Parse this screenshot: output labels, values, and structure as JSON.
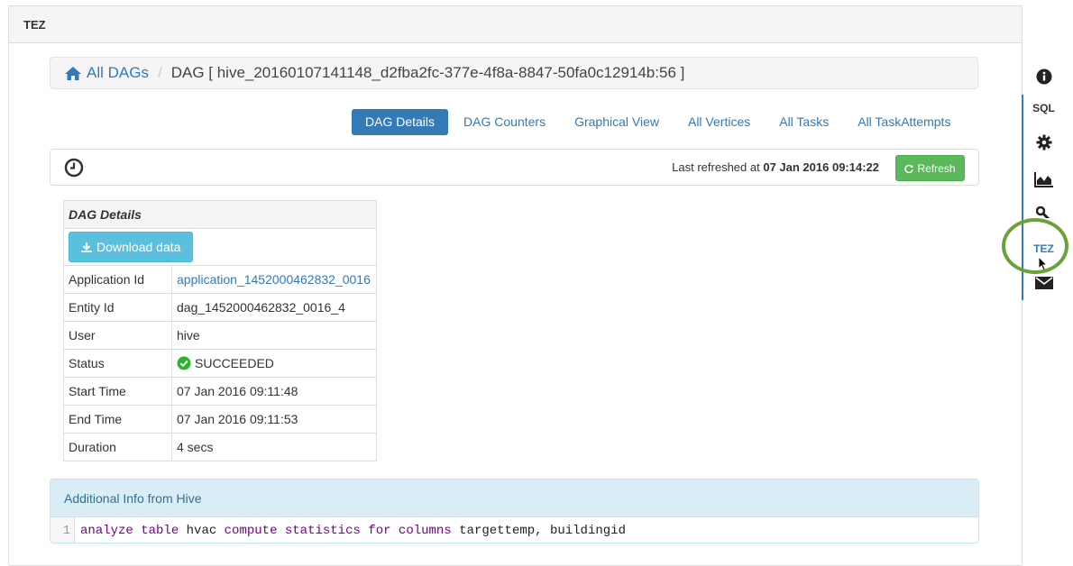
{
  "panel": {
    "title": "TEZ"
  },
  "breadcrumb": {
    "home_label": "All DAGs",
    "separator": "/",
    "current": "DAG [ hive_20160107141148_d2fba2fc-377e-4f8a-8847-50fa0c12914b:56 ]"
  },
  "tabs": [
    {
      "label": "DAG Details",
      "active": true
    },
    {
      "label": "DAG Counters",
      "active": false
    },
    {
      "label": "Graphical View",
      "active": false
    },
    {
      "label": "All Vertices",
      "active": false
    },
    {
      "label": "All Tasks",
      "active": false
    },
    {
      "label": "All TaskAttempts",
      "active": false
    }
  ],
  "refresh": {
    "prefix": "Last refreshed at",
    "timestamp": "07 Jan 2016 09:14:22",
    "button_label": "Refresh"
  },
  "details": {
    "title": "DAG Details",
    "download_label": "Download data",
    "rows": {
      "application_id": {
        "label": "Application Id",
        "value": "application_1452000462832_0016"
      },
      "entity_id": {
        "label": "Entity Id",
        "value": "dag_1452000462832_0016_4"
      },
      "user": {
        "label": "User",
        "value": "hive"
      },
      "status": {
        "label": "Status",
        "value": "SUCCEEDED"
      },
      "start_time": {
        "label": "Start Time",
        "value": "07 Jan 2016 09:11:48"
      },
      "end_time": {
        "label": "End Time",
        "value": "07 Jan 2016 09:11:53"
      },
      "duration": {
        "label": "Duration",
        "value": "4 secs"
      }
    }
  },
  "info": {
    "title": "Additional Info from Hive",
    "line_number": "1",
    "code": {
      "t1": "analyze",
      "t2": " ",
      "t3": "table",
      "t4": " hvac ",
      "t5": "compute",
      "t6": " ",
      "t7": "statistics",
      "t8": " ",
      "t9": "for",
      "t10": " ",
      "t11": "columns",
      "t12": " targettemp, buildingid"
    }
  },
  "rail": {
    "sql_label": "SQL",
    "tez_label": "TEZ"
  },
  "colors": {
    "primary": "#337ab7",
    "success": "#5cb85c",
    "info": "#5bc0de",
    "highlight_circle": "#6aa23a"
  }
}
